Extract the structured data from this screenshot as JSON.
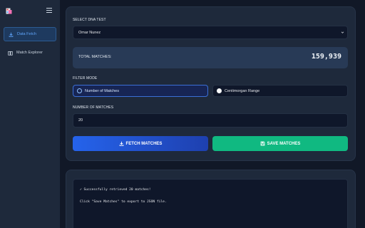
{
  "sidebar": {
    "logo_icon": "dna-app-logo-icon",
    "menu_icon": "hamburger-menu-icon",
    "items": [
      {
        "label": "Data Fetch",
        "icon": "download-icon",
        "active": true
      },
      {
        "label": "Match Explorer",
        "icon": "book-icon",
        "active": false
      }
    ]
  },
  "form": {
    "dna_test_label": "SELECT DNA TEST",
    "dna_test_value": "Omar Nunez",
    "total_matches_label": "TOTAL MATCHES:",
    "total_matches_value": "159,939",
    "filter_mode_label": "FILTER MODE",
    "filter_options": [
      {
        "label": "Number of Matches",
        "selected": true
      },
      {
        "label": "Centimorgan Range",
        "selected": false
      }
    ],
    "number_label": "NUMBER OF MATCHES",
    "number_value": "20",
    "fetch_button": "FETCH MATCHES",
    "save_button": "SAVE MATCHES"
  },
  "log": {
    "lines": [
      "✓ Successfully retrieved 20 matches!",
      "Click \"Save Matches\" to export to JSON file."
    ]
  },
  "colors": {
    "accent": "#2563eb",
    "success": "#10b981",
    "background": "#111827",
    "panel": "#1e293b"
  }
}
